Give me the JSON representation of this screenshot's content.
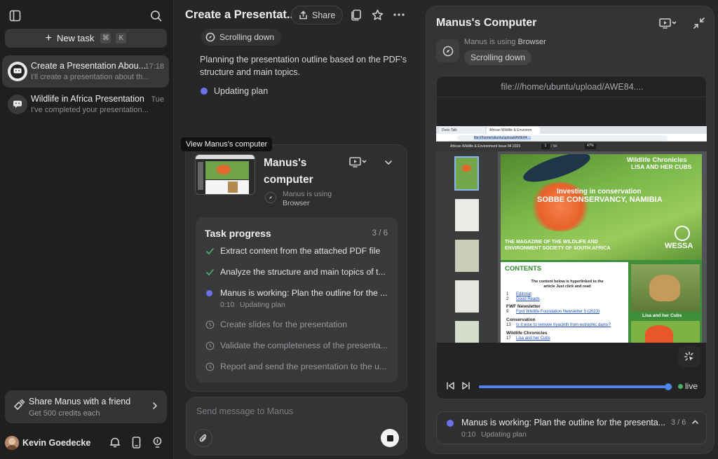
{
  "sidebar": {
    "new_task_label": "New task",
    "shortcut_cmd": "⌘",
    "shortcut_key": "K",
    "tasks": [
      {
        "title": "Create a Presentation Abou...",
        "subtitle": "I'll create a presentation about th...",
        "time": "17:18"
      },
      {
        "title": "Wildlife in Africa Presentation",
        "subtitle": "I've completed your presentation...",
        "time": "Tue"
      }
    ],
    "share": {
      "title": "Share Manus with a friend",
      "subtitle": "Get 500 credits each"
    },
    "user": {
      "name": "Kevin Goedecke"
    }
  },
  "chat": {
    "title": "Create a Presentat...",
    "share_label": "Share",
    "scrolling_pill": "Scrolling down",
    "planning_text": "Planning the presentation outline based on the PDF's structure and main topics.",
    "updating_plan": "Updating plan",
    "tooltip": "View Manus's computer",
    "computer_card": {
      "title": "Manus's computer",
      "using_label": "Manus is using",
      "tool": "Browser"
    },
    "task_progress": {
      "title": "Task progress",
      "count": "3 / 6",
      "steps": [
        {
          "label": "Extract content from the attached PDF file",
          "status": "done"
        },
        {
          "label": "Analyze the structure and main topics of t...",
          "status": "done"
        },
        {
          "label": "Manus is working: Plan the outline for the ...",
          "status": "active",
          "time": "0:10",
          "sub": "Updating plan"
        },
        {
          "label": "Create slides for the presentation",
          "status": "pending"
        },
        {
          "label": "Validate the completeness of the presenta...",
          "status": "pending"
        },
        {
          "label": "Report and send the presentation to the u...",
          "status": "pending"
        }
      ]
    },
    "input_placeholder": "Send message to Manus"
  },
  "computer": {
    "title": "Manus's Computer",
    "using_label": "Manus is using",
    "tool": "Browser",
    "action_pill": "Scrolling down",
    "url": "file:///home/ubuntu/upload/AWE84....",
    "live_label": "live",
    "progress": 0.98,
    "status": {
      "text": "Manus is working: Plan the outline for the presenta...",
      "count": "3 / 6",
      "time": "0:10",
      "sub": "Updating plan"
    }
  },
  "browser": {
    "tab1": "Doris Talk",
    "tab2": "African Wildlife & Environm",
    "url": "file:///home/ubuntu/upload/AWE84....",
    "doc_title": "African Wildlife & Environment Issue 84 2023",
    "page": "1",
    "pages": "/ 94",
    "zoom": "47%",
    "headline_top": "Wildlife Chronicles",
    "headline_sub": "LISA AND HER CUBS",
    "cover_line1": "Investing in conservation",
    "cover_line2": "SOBBE CONSERVANCY, NAMIBIA",
    "magazine_line": "THE MAGAZINE OF THE WILDLIFE AND ENVIRONMENT SOCIETY OF SOUTH AFRICA",
    "logo": "WESSA",
    "contents_title": "CONTENTS",
    "contents_intro": "The content below is hyperlinked to the article Just click and read",
    "contents": [
      {
        "num": "1",
        "label": "Editorial"
      },
      {
        "num": "2",
        "label": "Good Reads"
      }
    ],
    "sections": [
      {
        "head": "FWF Newsletter",
        "num": "9",
        "label": "Ford Wildlife Foundation Newsletter 5 (2023)"
      },
      {
        "head": "Conservation",
        "num": "13",
        "label": "Is it wise to remove hyacinth from eutrophic dams?"
      },
      {
        "head": "Wildlife Chronicles",
        "num": "17",
        "label": "Lisa and her Cubs"
      }
    ],
    "lion_caption": "Lisa and her Cubs"
  }
}
